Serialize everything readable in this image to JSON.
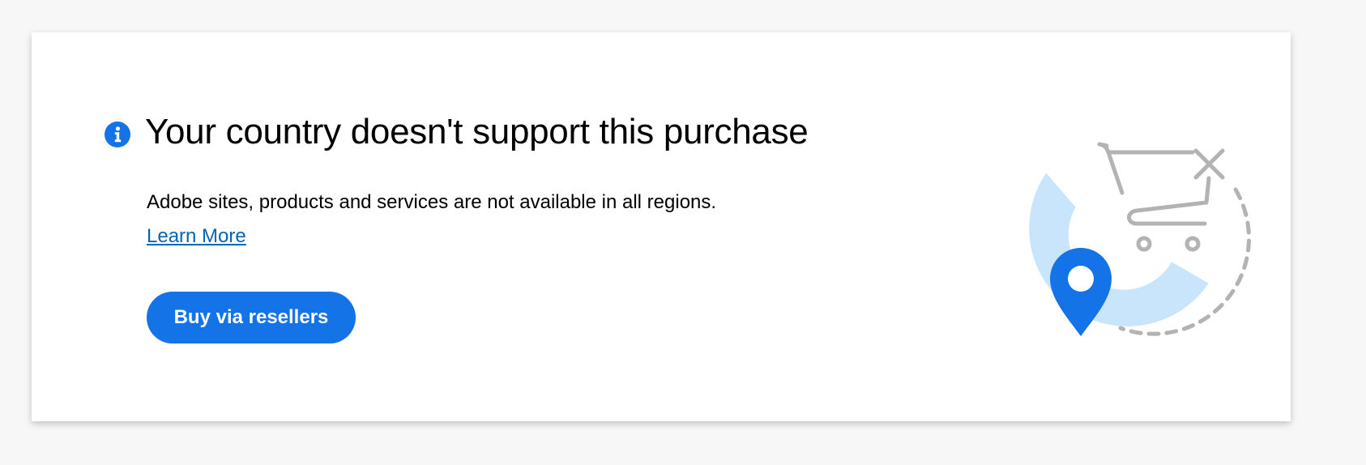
{
  "notice": {
    "title": "Your country doesn't support this purchase",
    "description": "Adobe sites, products and services are not available in all regions.",
    "learn_more_label": "Learn More",
    "buy_button_label": "Buy via resellers",
    "info_icon": "info-icon",
    "illustration_icons": [
      "location-pin-icon",
      "shopping-cart-icon",
      "close-icon"
    ]
  },
  "colors": {
    "page_background": "#f7f7f7",
    "card_background": "#ffffff",
    "accent_blue": "#1473e6",
    "link_blue": "#0265b6",
    "light_blue": "#c8e5fb",
    "gray": "#b3b3b3"
  }
}
